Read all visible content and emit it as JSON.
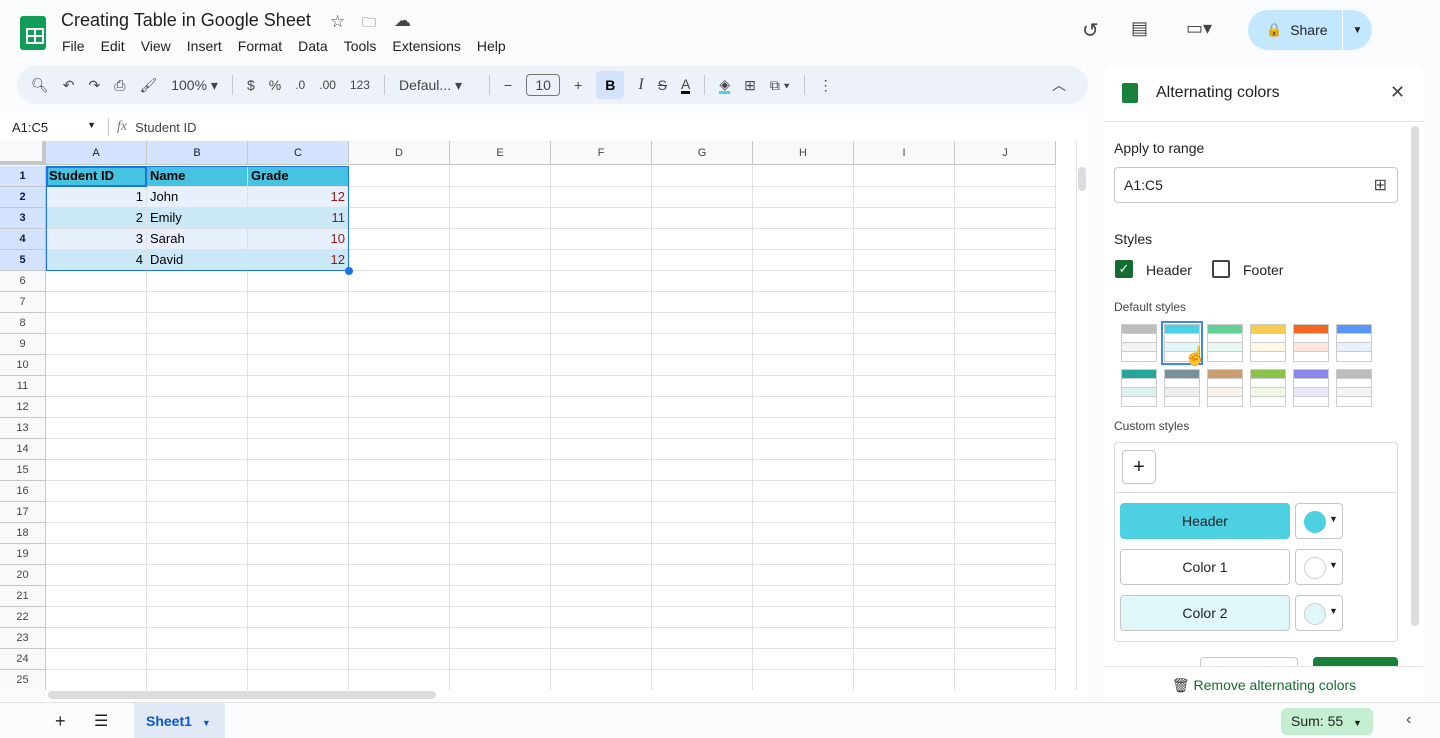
{
  "doc": {
    "title": "Creating Table in Google Sheet",
    "menu": [
      "File",
      "Edit",
      "View",
      "Insert",
      "Format",
      "Data",
      "Tools",
      "Extensions",
      "Help"
    ]
  },
  "header": {
    "share_label": "Share"
  },
  "toolbar": {
    "zoom": "100%",
    "currency": "$",
    "percent": "%",
    "dec_minus": ".0",
    "dec_plus": ".00",
    "format_123": "123",
    "font": "Defaul...",
    "font_size": "10",
    "bold": "B",
    "italic": "I"
  },
  "formula_bar": {
    "name_box": "A1:C5",
    "fx": "fx",
    "value": "Student ID"
  },
  "grid": {
    "columns": [
      "A",
      "B",
      "C",
      "D",
      "E",
      "F",
      "G",
      "H",
      "I",
      "J"
    ],
    "row_count": 25,
    "cells": [
      [
        "Student ID",
        "Name",
        "Grade"
      ],
      [
        "1",
        "John",
        "12"
      ],
      [
        "2",
        "Emily",
        "11"
      ],
      [
        "3",
        "Sarah",
        "10"
      ],
      [
        "4",
        "David",
        "12"
      ]
    ],
    "colors": {
      "header": "#46c3e0",
      "color1": "#e8f0fe",
      "color2": "#cbe8f7"
    }
  },
  "panel": {
    "title": "Alternating colors",
    "apply_label": "Apply to range",
    "range": "A1:C5",
    "styles_label": "Styles",
    "header_label": "Header",
    "header_checked": true,
    "footer_label": "Footer",
    "footer_checked": false,
    "default_styles_label": "Default styles",
    "swatches": [
      [
        "#bdbdbd",
        "#f3f3f3"
      ],
      [
        "#4dd0e1",
        "#e0f7fa"
      ],
      [
        "#63d297",
        "#e7f9ef"
      ],
      [
        "#f7cb4d",
        "#fef8e3"
      ],
      [
        "#f46524",
        "#ffe6dd"
      ],
      [
        "#5b95f9",
        "#e8f0fe"
      ],
      [
        "#26a69a",
        "#ddf2f0"
      ],
      [
        "#78909c",
        "#ebeff1"
      ],
      [
        "#ca9c6e",
        "#f8f1ea"
      ],
      [
        "#8bc34a",
        "#eef7e3"
      ],
      [
        "#8989eb",
        "#e8e7fc"
      ],
      [
        "#bdbdbd",
        "#f3f3f3"
      ]
    ],
    "selected_swatch": 1,
    "custom_styles_label": "Custom styles",
    "add": "+",
    "header_btn": "Header",
    "color1_btn": "Color 1",
    "color2_btn": "Color 2",
    "header_color": "#4dd0e1",
    "color1": "#ffffff",
    "color2": "#e0f7fa",
    "remove_label": "Remove alternating colors"
  },
  "bottom": {
    "sheet": "Sheet1",
    "sum": "Sum: 55"
  }
}
